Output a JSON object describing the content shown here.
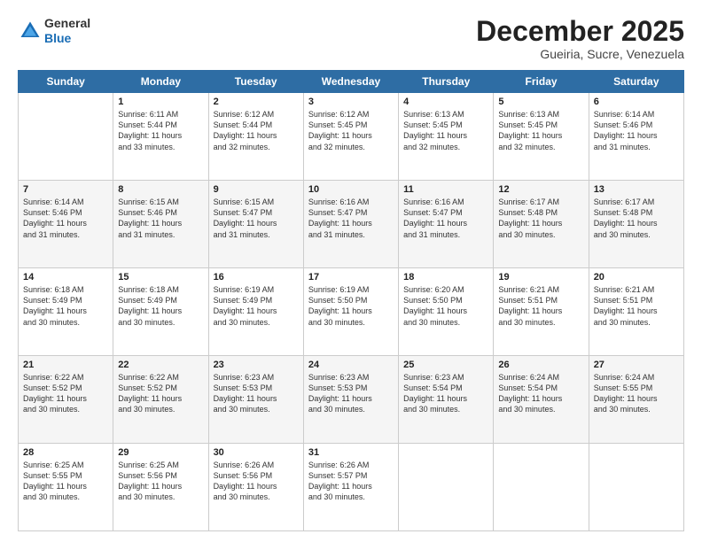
{
  "logo": {
    "general": "General",
    "blue": "Blue"
  },
  "header": {
    "month": "December 2025",
    "location": "Gueiria, Sucre, Venezuela"
  },
  "days_of_week": [
    "Sunday",
    "Monday",
    "Tuesday",
    "Wednesday",
    "Thursday",
    "Friday",
    "Saturday"
  ],
  "weeks": [
    [
      {
        "day": "",
        "info": ""
      },
      {
        "day": "1",
        "info": "Sunrise: 6:11 AM\nSunset: 5:44 PM\nDaylight: 11 hours\nand 33 minutes."
      },
      {
        "day": "2",
        "info": "Sunrise: 6:12 AM\nSunset: 5:44 PM\nDaylight: 11 hours\nand 32 minutes."
      },
      {
        "day": "3",
        "info": "Sunrise: 6:12 AM\nSunset: 5:45 PM\nDaylight: 11 hours\nand 32 minutes."
      },
      {
        "day": "4",
        "info": "Sunrise: 6:13 AM\nSunset: 5:45 PM\nDaylight: 11 hours\nand 32 minutes."
      },
      {
        "day": "5",
        "info": "Sunrise: 6:13 AM\nSunset: 5:45 PM\nDaylight: 11 hours\nand 32 minutes."
      },
      {
        "day": "6",
        "info": "Sunrise: 6:14 AM\nSunset: 5:46 PM\nDaylight: 11 hours\nand 31 minutes."
      }
    ],
    [
      {
        "day": "7",
        "info": "Sunrise: 6:14 AM\nSunset: 5:46 PM\nDaylight: 11 hours\nand 31 minutes."
      },
      {
        "day": "8",
        "info": "Sunrise: 6:15 AM\nSunset: 5:46 PM\nDaylight: 11 hours\nand 31 minutes."
      },
      {
        "day": "9",
        "info": "Sunrise: 6:15 AM\nSunset: 5:47 PM\nDaylight: 11 hours\nand 31 minutes."
      },
      {
        "day": "10",
        "info": "Sunrise: 6:16 AM\nSunset: 5:47 PM\nDaylight: 11 hours\nand 31 minutes."
      },
      {
        "day": "11",
        "info": "Sunrise: 6:16 AM\nSunset: 5:47 PM\nDaylight: 11 hours\nand 31 minutes."
      },
      {
        "day": "12",
        "info": "Sunrise: 6:17 AM\nSunset: 5:48 PM\nDaylight: 11 hours\nand 30 minutes."
      },
      {
        "day": "13",
        "info": "Sunrise: 6:17 AM\nSunset: 5:48 PM\nDaylight: 11 hours\nand 30 minutes."
      }
    ],
    [
      {
        "day": "14",
        "info": "Sunrise: 6:18 AM\nSunset: 5:49 PM\nDaylight: 11 hours\nand 30 minutes."
      },
      {
        "day": "15",
        "info": "Sunrise: 6:18 AM\nSunset: 5:49 PM\nDaylight: 11 hours\nand 30 minutes."
      },
      {
        "day": "16",
        "info": "Sunrise: 6:19 AM\nSunset: 5:49 PM\nDaylight: 11 hours\nand 30 minutes."
      },
      {
        "day": "17",
        "info": "Sunrise: 6:19 AM\nSunset: 5:50 PM\nDaylight: 11 hours\nand 30 minutes."
      },
      {
        "day": "18",
        "info": "Sunrise: 6:20 AM\nSunset: 5:50 PM\nDaylight: 11 hours\nand 30 minutes."
      },
      {
        "day": "19",
        "info": "Sunrise: 6:21 AM\nSunset: 5:51 PM\nDaylight: 11 hours\nand 30 minutes."
      },
      {
        "day": "20",
        "info": "Sunrise: 6:21 AM\nSunset: 5:51 PM\nDaylight: 11 hours\nand 30 minutes."
      }
    ],
    [
      {
        "day": "21",
        "info": "Sunrise: 6:22 AM\nSunset: 5:52 PM\nDaylight: 11 hours\nand 30 minutes."
      },
      {
        "day": "22",
        "info": "Sunrise: 6:22 AM\nSunset: 5:52 PM\nDaylight: 11 hours\nand 30 minutes."
      },
      {
        "day": "23",
        "info": "Sunrise: 6:23 AM\nSunset: 5:53 PM\nDaylight: 11 hours\nand 30 minutes."
      },
      {
        "day": "24",
        "info": "Sunrise: 6:23 AM\nSunset: 5:53 PM\nDaylight: 11 hours\nand 30 minutes."
      },
      {
        "day": "25",
        "info": "Sunrise: 6:23 AM\nSunset: 5:54 PM\nDaylight: 11 hours\nand 30 minutes."
      },
      {
        "day": "26",
        "info": "Sunrise: 6:24 AM\nSunset: 5:54 PM\nDaylight: 11 hours\nand 30 minutes."
      },
      {
        "day": "27",
        "info": "Sunrise: 6:24 AM\nSunset: 5:55 PM\nDaylight: 11 hours\nand 30 minutes."
      }
    ],
    [
      {
        "day": "28",
        "info": "Sunrise: 6:25 AM\nSunset: 5:55 PM\nDaylight: 11 hours\nand 30 minutes."
      },
      {
        "day": "29",
        "info": "Sunrise: 6:25 AM\nSunset: 5:56 PM\nDaylight: 11 hours\nand 30 minutes."
      },
      {
        "day": "30",
        "info": "Sunrise: 6:26 AM\nSunset: 5:56 PM\nDaylight: 11 hours\nand 30 minutes."
      },
      {
        "day": "31",
        "info": "Sunrise: 6:26 AM\nSunset: 5:57 PM\nDaylight: 11 hours\nand 30 minutes."
      },
      {
        "day": "",
        "info": ""
      },
      {
        "day": "",
        "info": ""
      },
      {
        "day": "",
        "info": ""
      }
    ]
  ]
}
